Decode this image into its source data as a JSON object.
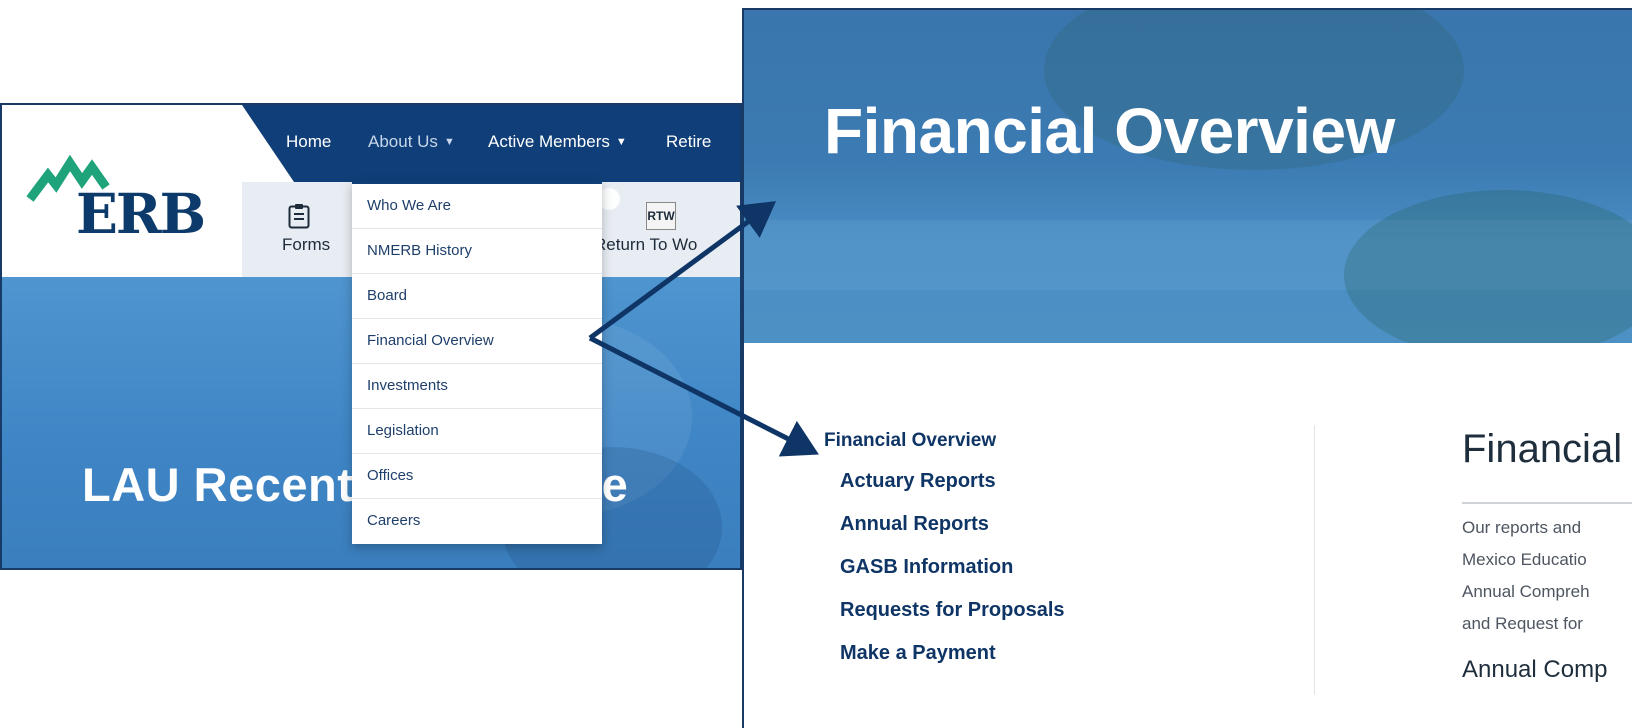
{
  "left_site": {
    "logo": {
      "text": "ERB"
    },
    "nav": {
      "items": [
        {
          "label": "Home"
        },
        {
          "label": "About Us"
        },
        {
          "label": "Active Members"
        },
        {
          "label": "Retire"
        }
      ]
    },
    "quick_links": {
      "forms_label": "Forms",
      "rtw_icon_text": "RTW",
      "return_to_work_label": "Return To Wo"
    },
    "dropdown": {
      "items": [
        "Who We Are",
        "NMERB History",
        "Board",
        "Financial Overview",
        "Investments",
        "Legislation",
        "Offices",
        "Careers"
      ]
    },
    "hero_title": "LAU Recent              nge"
  },
  "right_site": {
    "hero_title": "Financial Overview",
    "sidenav": {
      "main": "Financial Overview",
      "items": [
        "Actuary Reports",
        "Annual Reports",
        "GASB Information",
        "Requests for Proposals",
        "Make a Payment"
      ]
    },
    "content": {
      "title": "Financial",
      "paragraph_lines": [
        "Our reports and",
        "Mexico Educatio",
        "Annual Compreh",
        "and Request for"
      ],
      "subheading": "Annual Comp"
    }
  },
  "colors": {
    "navy": "#0f3e78",
    "logo_green": "#1fa37a",
    "hero_blue": "#4f95cf",
    "arrow": "#0f3566"
  }
}
